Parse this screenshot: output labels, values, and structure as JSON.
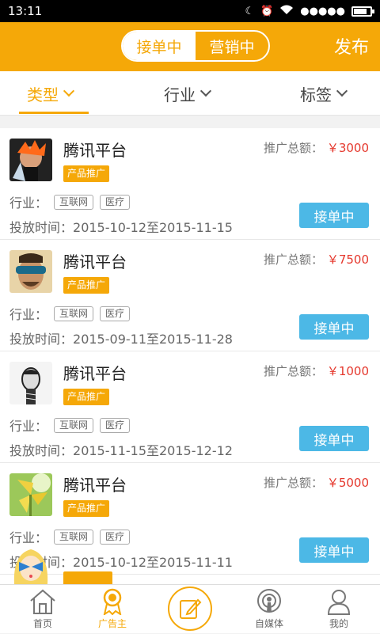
{
  "status": {
    "time": "13:11",
    "signal_dots": "●●●●●",
    "battery_level": 0.8
  },
  "header": {
    "tabs": [
      "接单中",
      "营销中"
    ],
    "publish_label": "发布"
  },
  "filters": [
    {
      "label": "类型",
      "active": true
    },
    {
      "label": "行业",
      "active": false
    },
    {
      "label": "标签",
      "active": false
    }
  ],
  "cards": [
    {
      "title": "腾讯平台",
      "tag": "产品推广",
      "amount_label": "推广总额：",
      "amount": "￥3000",
      "industry_label": "行业：",
      "industries": [
        "互联网",
        "医疗"
      ],
      "date_label": "投放时间：",
      "dates": "2015-10-12至2015-11-15",
      "button": "接单中",
      "avatar": "anime-avatar"
    },
    {
      "title": "腾讯平台",
      "tag": "产品推广",
      "amount_label": "推广总额：",
      "amount": "￥7500",
      "industry_label": "行业：",
      "industries": [
        "互联网",
        "医疗"
      ],
      "date_label": "投放时间：",
      "dates": "2015-09-11至2015-11-28",
      "button": "接单中",
      "avatar": "sunglasses-avatar"
    },
    {
      "title": "腾讯平台",
      "tag": "产品推广",
      "amount_label": "推广总额：",
      "amount": "￥1000",
      "industry_label": "行业：",
      "industries": [
        "互联网",
        "医疗"
      ],
      "date_label": "投放时间：",
      "dates": "2015-11-15至2015-12-12",
      "button": "接单中",
      "avatar": "sketch-avatar"
    },
    {
      "title": "腾讯平台",
      "tag": "产品推广",
      "amount_label": "推广总额：",
      "amount": "￥5000",
      "industry_label": "行业：",
      "industries": [
        "互联网",
        "医疗"
      ],
      "date_label": "投放时间：",
      "dates": "2015-10-12至2015-11-11",
      "button": "接单中",
      "avatar": "pinwheel-avatar"
    }
  ],
  "nav": [
    {
      "label": "首页",
      "icon": "home-icon",
      "active": false
    },
    {
      "label": "广告主",
      "icon": "medal-icon",
      "active": true
    },
    {
      "label": "",
      "icon": "edit-icon",
      "active": false
    },
    {
      "label": "自媒体",
      "icon": "podcast-icon",
      "active": false
    },
    {
      "label": "我的",
      "icon": "user-icon",
      "active": false
    }
  ],
  "colors": {
    "accent": "#f5a808",
    "button_blue": "#4cb8e6",
    "amount_red": "#e5382d"
  }
}
